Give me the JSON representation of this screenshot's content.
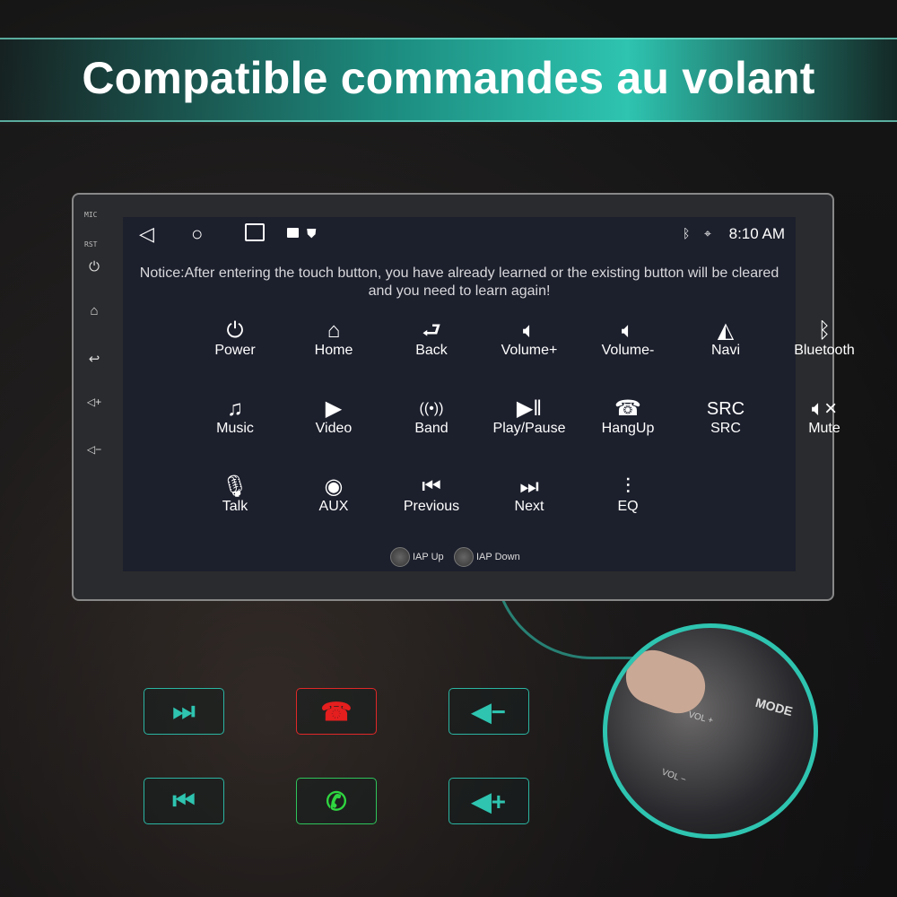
{
  "banner": {
    "title": "Compatible commandes au volant",
    "color": "#2ec4b0"
  },
  "side_panel": {
    "mic_label": "MIC",
    "rst_label": "RST",
    "icons": [
      "power-icon",
      "home-icon",
      "back-icon",
      "volume-up-icon",
      "volume-down-icon"
    ]
  },
  "status_bar": {
    "time": "8:10 AM",
    "icons": [
      "back-triangle-icon",
      "home-circle-icon",
      "recents-square-icon",
      "image-icon",
      "shield-icon",
      "bluetooth-icon",
      "location-icon"
    ]
  },
  "notice": "Notice:After entering the touch button, you have already learned or the existing button will be cleared and you need to learn again!",
  "buttons": [
    {
      "label": "Power",
      "icon": "⏻"
    },
    {
      "label": "Home",
      "icon": "⌂"
    },
    {
      "label": "Back",
      "icon": "⮐"
    },
    {
      "label": "Volume+",
      "icon": "🔈︎"
    },
    {
      "label": "Volume-",
      "icon": "🔈︎"
    },
    {
      "label": "Navi",
      "icon": "◭"
    },
    {
      "label": "Bluetooth",
      "icon": "ᛒ"
    },
    {
      "label": "Music",
      "icon": "♫"
    },
    {
      "label": "Video",
      "icon": "▶"
    },
    {
      "label": "Band",
      "icon": "((•))"
    },
    {
      "label": "Play/Pause",
      "icon": "▶‖"
    },
    {
      "label": "HangUp",
      "icon": "☎"
    },
    {
      "label": "SRC",
      "icon": "SRC"
    },
    {
      "label": "Mute",
      "icon": "🔈︎×"
    },
    {
      "label": "Talk",
      "icon": "🎙︎"
    },
    {
      "label": "AUX",
      "icon": "◉"
    },
    {
      "label": "Previous",
      "icon": "⏮︎"
    },
    {
      "label": "Next",
      "icon": "⏭︎"
    },
    {
      "label": "EQ",
      "icon": "⫶"
    }
  ],
  "iap": {
    "up": "IAP Up",
    "down": "IAP Down"
  },
  "keys": [
    {
      "name": "next-track",
      "glyph": "⏭︎",
      "color": "#2ec4b0"
    },
    {
      "name": "hang-up",
      "glyph": "☎",
      "color": "#e51e1e"
    },
    {
      "name": "volume-down",
      "glyph": "◀−",
      "color": "#2ec4b0"
    },
    {
      "name": "previous-track",
      "glyph": "⏮︎",
      "color": "#2ec4b0"
    },
    {
      "name": "answer-call",
      "glyph": "✆",
      "color": "#2fd640"
    },
    {
      "name": "volume-up",
      "glyph": "◀+",
      "color": "#2ec4b0"
    }
  ],
  "inset": {
    "mode_label": "MODE",
    "vol_up": "VOL +",
    "vol_down": "VOL −"
  }
}
